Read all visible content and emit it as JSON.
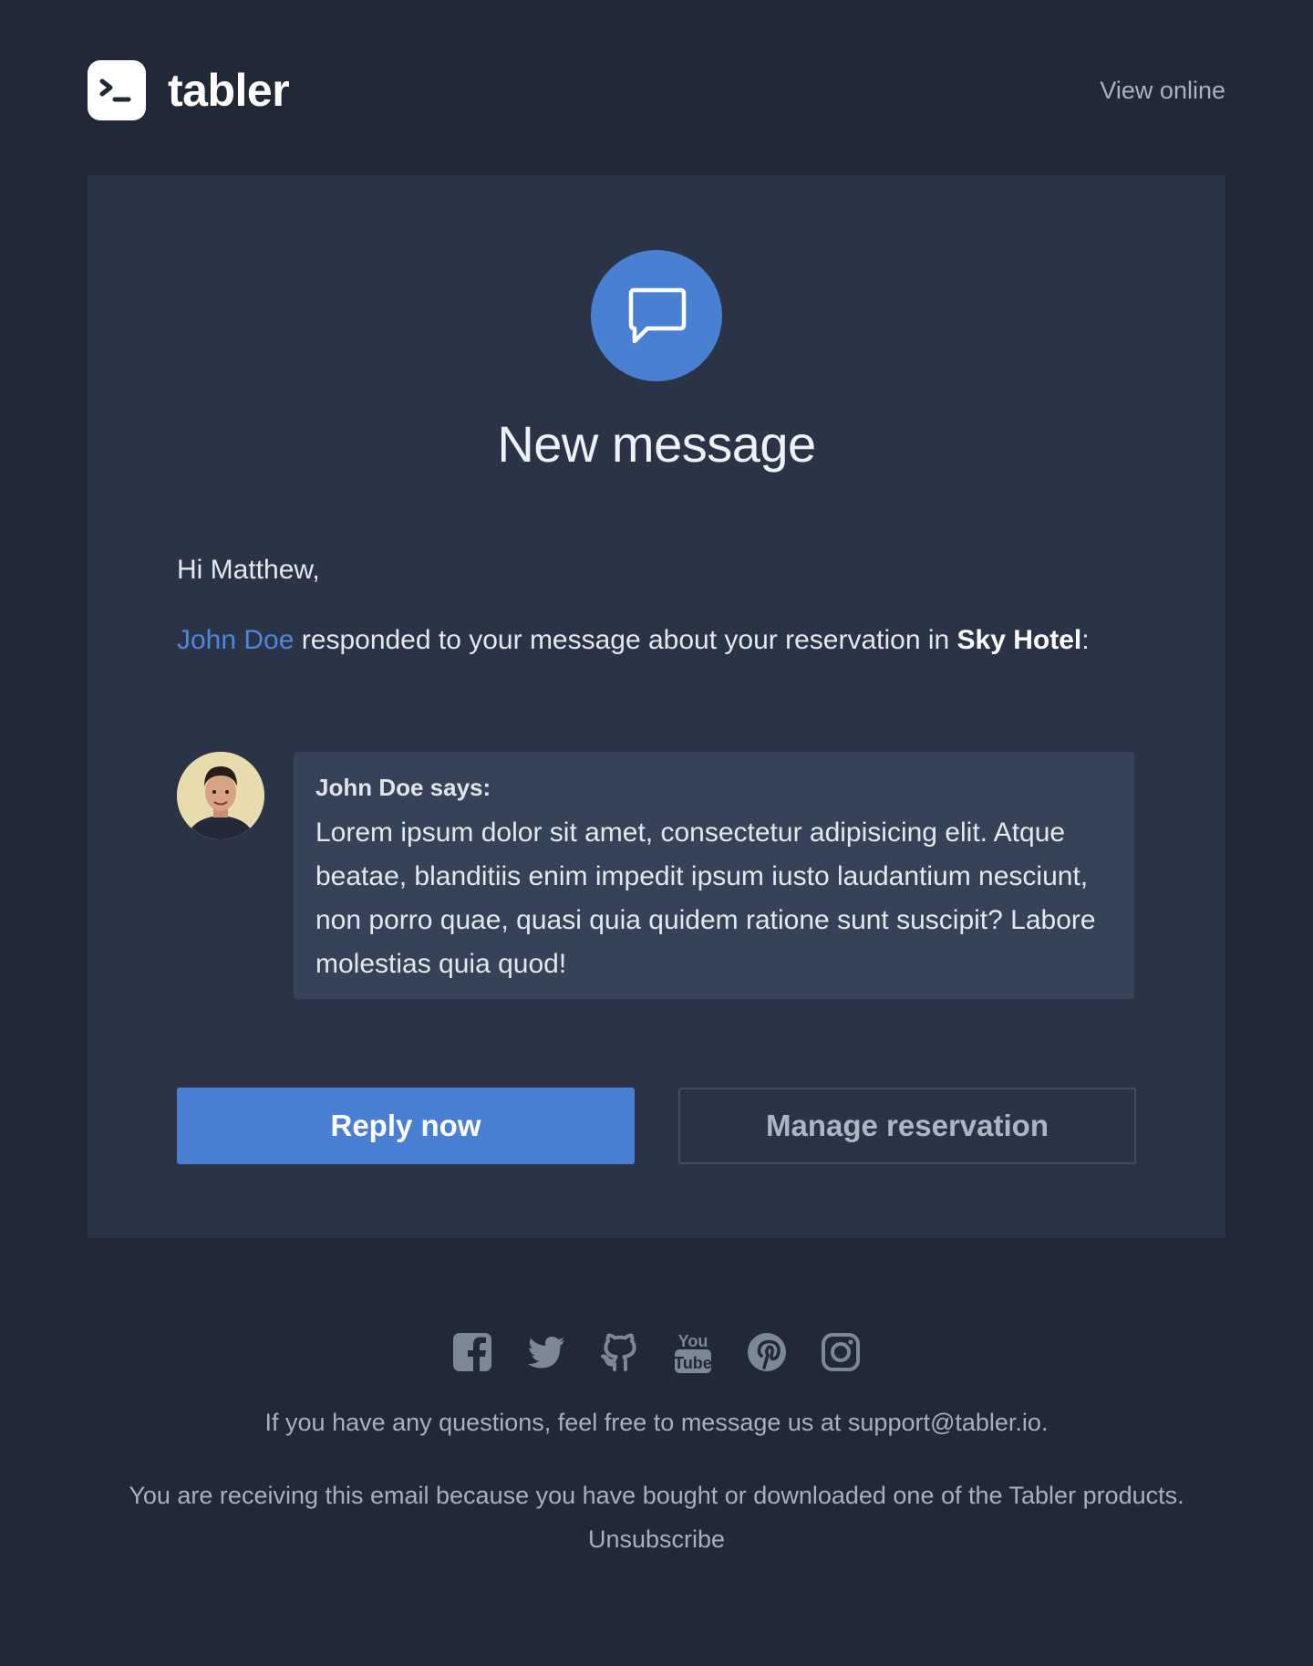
{
  "header": {
    "brand_name": "tabler",
    "view_online": "View online"
  },
  "card": {
    "icon": "message-icon",
    "title": "New message",
    "greeting": "Hi Matthew,",
    "intro": {
      "author_link": "John Doe",
      "text_before": " responded to your message about your reservation in ",
      "hotel": "Sky Hotel",
      "text_after": ":"
    },
    "quote": {
      "author": "John Doe says:",
      "text": "Lorem ipsum dolor sit amet, consectetur adipisicing elit. Atque beatae, blanditiis enim impedit ipsum iusto laudantium nesciunt, non porro quae, quasi quia quidem ratione sunt suscipit? Labore molestias quia quod!"
    },
    "buttons": {
      "primary": "Reply now",
      "secondary": "Manage reservation"
    }
  },
  "footer": {
    "social_icons": [
      "facebook-icon",
      "twitter-icon",
      "github-icon",
      "youtube-icon",
      "pinterest-icon",
      "instagram-icon"
    ],
    "youtube_top": "You",
    "youtube_bottom": "Tube",
    "questions": "If you have any questions, feel free to message us at support@tabler.io.",
    "receiving": "You are receiving this email because you have bought or downloaded one of the Tabler products.",
    "unsubscribe": "Unsubscribe"
  },
  "colors": {
    "background": "#212837",
    "card": "#2b3447",
    "accent": "#4a80d4",
    "quote_bg": "#364258"
  }
}
